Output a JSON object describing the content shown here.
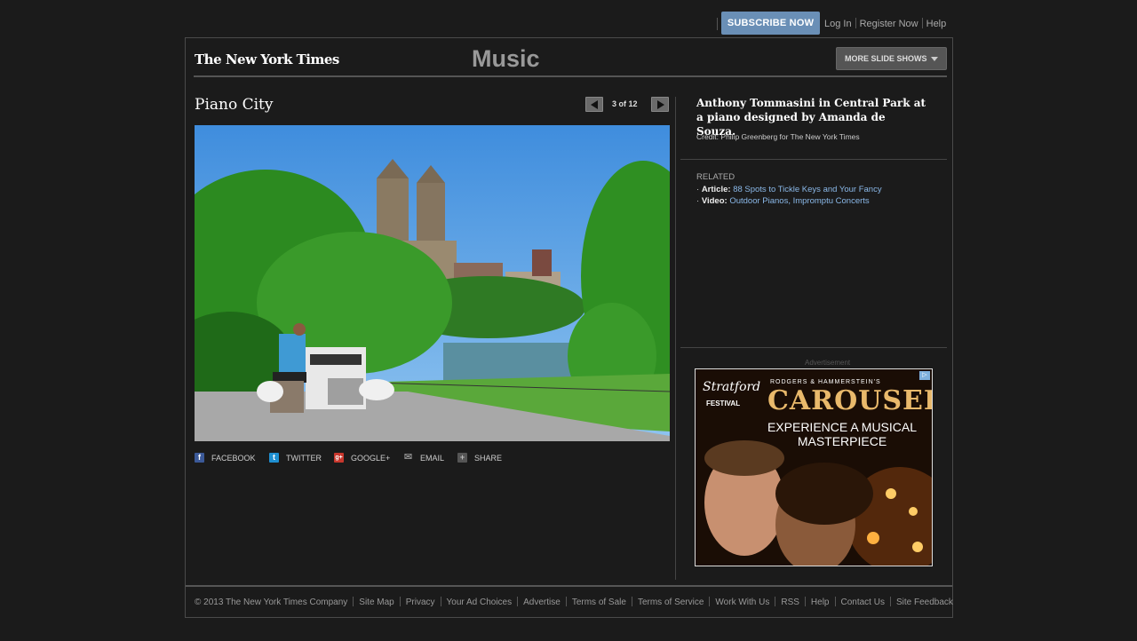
{
  "topbar": {
    "subscribe_label": "SUBSCRIBE NOW",
    "links": [
      "Log In",
      "Register Now",
      "Help"
    ]
  },
  "header": {
    "logo_text": "The New York Times",
    "section_title": "Music",
    "more_slideshows_label": "MORE SLIDE SHOWS"
  },
  "slideshow": {
    "title": "Piano City",
    "counter": "3 of 12",
    "share": [
      {
        "label": "FACEBOOK",
        "icon": "facebook-icon",
        "color": "#3b5998",
        "glyph": "f"
      },
      {
        "label": "TWITTER",
        "icon": "twitter-icon",
        "color": "#1f8fd1",
        "glyph": "t"
      },
      {
        "label": "GOOGLE+",
        "icon": "google-plus-icon",
        "color": "#c8372d",
        "glyph": "g+"
      },
      {
        "label": "EMAIL",
        "icon": "email-icon",
        "color": "#777777",
        "glyph": "✉"
      },
      {
        "label": "SHARE",
        "icon": "share-plus-icon",
        "color": "#777777",
        "glyph": "+"
      }
    ]
  },
  "sidebar": {
    "caption": "Anthony Tommasini in Central Park at a piano designed by Amanda de Souza.",
    "credit": "Credit: Philip Greenberg for The New York Times",
    "related_heading": "RELATED",
    "related": [
      {
        "kind": "Article:",
        "link": "88 Spots to Tickle Keys and Your Fancy"
      },
      {
        "kind": "Video:",
        "link": "Outdoor Pianos, Impromptu Concerts"
      }
    ],
    "ad_label": "Advertisement",
    "ad": {
      "festival_line1": "Stratford",
      "festival_line2": "FESTIVAL",
      "presents": "RODGERS & HAMMERSTEIN'S",
      "show": "CAROUSEL",
      "tagline": "EXPERIENCE A MUSICAL MASTERPIECE"
    }
  },
  "footer": {
    "links": [
      "© 2013 The New York Times Company",
      "Site Map",
      "Privacy",
      "Your Ad Choices",
      "Advertise",
      "Terms of Sale",
      "Terms of Service",
      "Work With Us",
      "RSS",
      "Help",
      "Contact Us",
      "Site Feedback"
    ]
  },
  "colors": {
    "accent": "#6a8fb6",
    "link": "#8ab8e8",
    "background": "#1b1b1b"
  }
}
